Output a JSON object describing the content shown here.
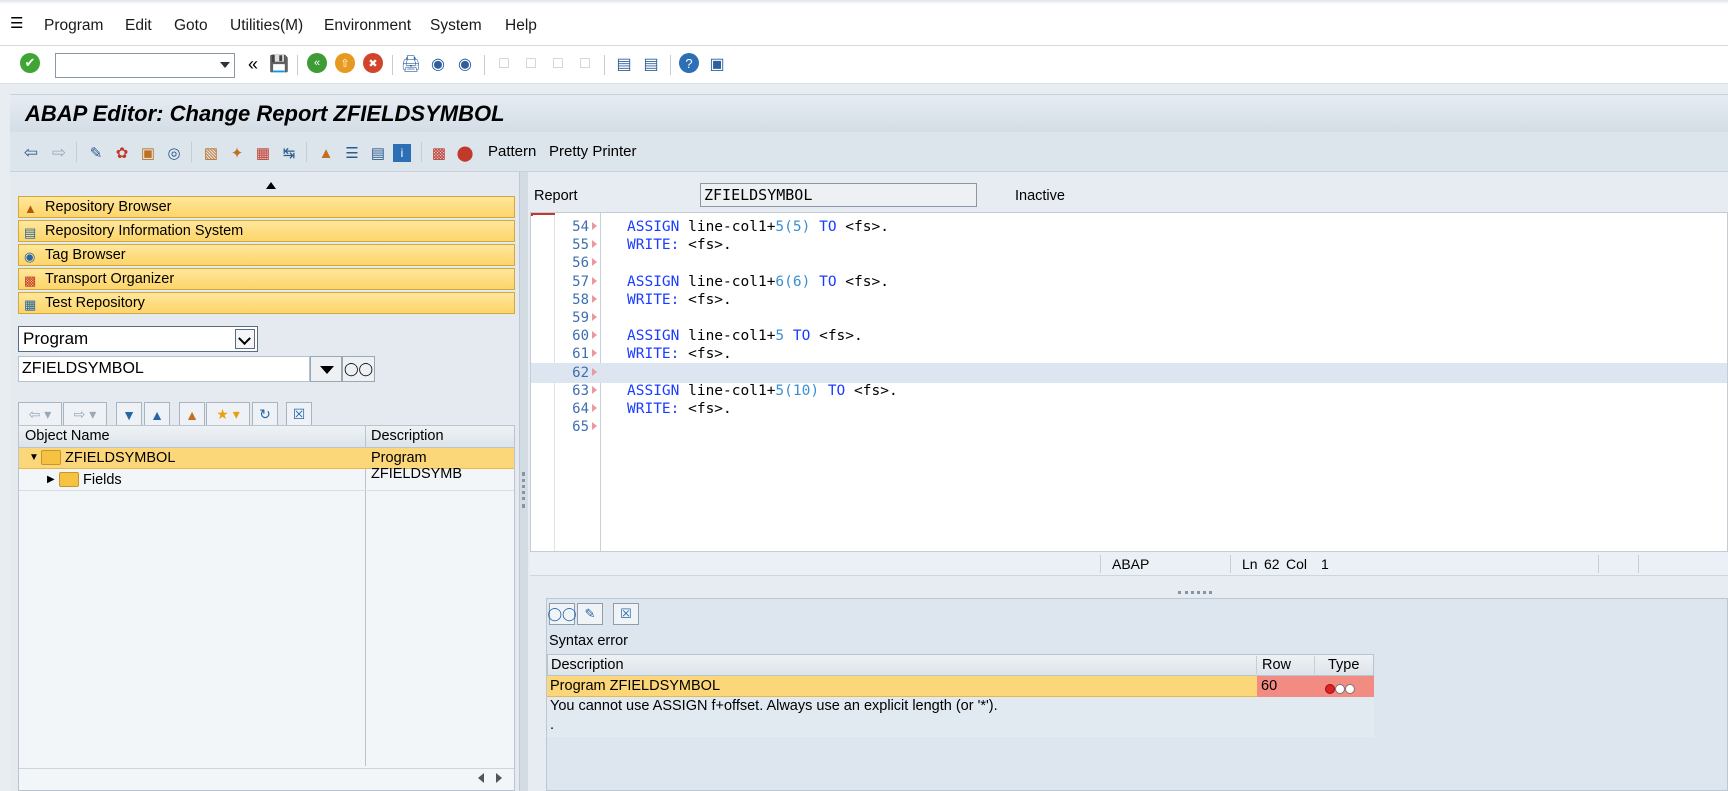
{
  "menu": [
    "Program",
    "Edit",
    "Goto",
    "Utilities(M)",
    "Environment",
    "System",
    "Help"
  ],
  "title": "ABAP Editor: Change Report ZFIELDSYMBOL",
  "app_toolbar": {
    "pattern": "Pattern",
    "pretty_printer": "Pretty Printer"
  },
  "nav": {
    "buttons": [
      "Repository Browser",
      "Repository Information System",
      "Tag Browser",
      "Transport Organizer",
      "Test Repository"
    ],
    "object_type": "Program",
    "object_name": "ZFIELDSYMBOL"
  },
  "tree": {
    "col_name": "Object Name",
    "col_desc": "Description",
    "root_name": "ZFIELDSYMBOL",
    "root_desc": "Program ZFIELDSYMB",
    "child_name": "Fields"
  },
  "editor": {
    "report_label": "Report",
    "report_value": "ZFIELDSYMBOL",
    "status": "Inactive",
    "lines": [
      {
        "n": "54",
        "kw1": "ASSIGN",
        "a": " line-col1+",
        "n1": "5",
        "p1": "(",
        "n2": "5",
        "p2": ")",
        "kw2": " TO",
        "b": " <fs>."
      },
      {
        "n": "55",
        "kw1": "WRITE:",
        "b": " <fs>."
      },
      {
        "n": "56"
      },
      {
        "n": "57",
        "kw1": "ASSIGN",
        "a": " line-col1+",
        "n1": "6",
        "p1": "(",
        "n2": "6",
        "p2": ")",
        "kw2": " TO",
        "b": " <fs>."
      },
      {
        "n": "58",
        "kw1": "WRITE:",
        "b": " <fs>."
      },
      {
        "n": "59"
      },
      {
        "n": "60",
        "kw1": "ASSIGN",
        "a": " line-col1+",
        "n1": "5",
        "kw2": " TO",
        "b": " <fs>."
      },
      {
        "n": "61",
        "kw1": "WRITE:",
        "b": " <fs>."
      },
      {
        "n": "62"
      },
      {
        "n": "63",
        "kw1": "ASSIGN",
        "a": " line-col1+",
        "n1": "5",
        "p1": "(",
        "n2": "10",
        "p2": ")",
        "kw2": " TO",
        "b": " <fs>."
      },
      {
        "n": "64",
        "kw1": "WRITE:",
        "b": " <fs>."
      },
      {
        "n": "65"
      }
    ]
  },
  "statusbar": {
    "lang": "ABAP",
    "ln_label": "Ln",
    "ln": "62",
    "col_label": "Col",
    "col": "1"
  },
  "errors": {
    "title": "Syntax error",
    "col_desc": "Description",
    "col_row": "Row",
    "col_type": "Type",
    "program": "Program ZFIELDSYMBOL",
    "row": "60",
    "message": "You cannot use ASSIGN f+offset. Always use an explicit length (or '*').",
    "message2": "."
  }
}
